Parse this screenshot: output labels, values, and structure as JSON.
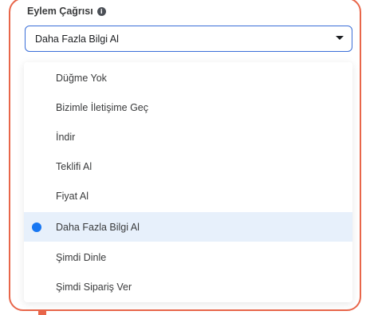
{
  "field": {
    "label": "Eylem Çağrısı",
    "info_icon_glyph": "i",
    "selected_value": "Daha Fazla Bilgi Al"
  },
  "options": [
    {
      "label": "Düğme Yok",
      "selected": false
    },
    {
      "label": "Bizimle İletişime Geç",
      "selected": false
    },
    {
      "label": "İndir",
      "selected": false
    },
    {
      "label": "Teklifi Al",
      "selected": false
    },
    {
      "label": "Fiyat Al",
      "selected": false
    },
    {
      "label": "Daha Fazla Bilgi Al",
      "selected": true
    },
    {
      "label": "Şimdi Dinle",
      "selected": false
    },
    {
      "label": "Şimdi Sipariş Ver",
      "selected": false
    }
  ],
  "colors": {
    "highlight_frame": "#e8664a",
    "accent": "#1877f2",
    "selected_row_bg": "#e7f0fb",
    "select_border": "#3b6fd8"
  },
  "icons": [
    "info-icon",
    "chevron-down-icon",
    "radio-icon"
  ]
}
